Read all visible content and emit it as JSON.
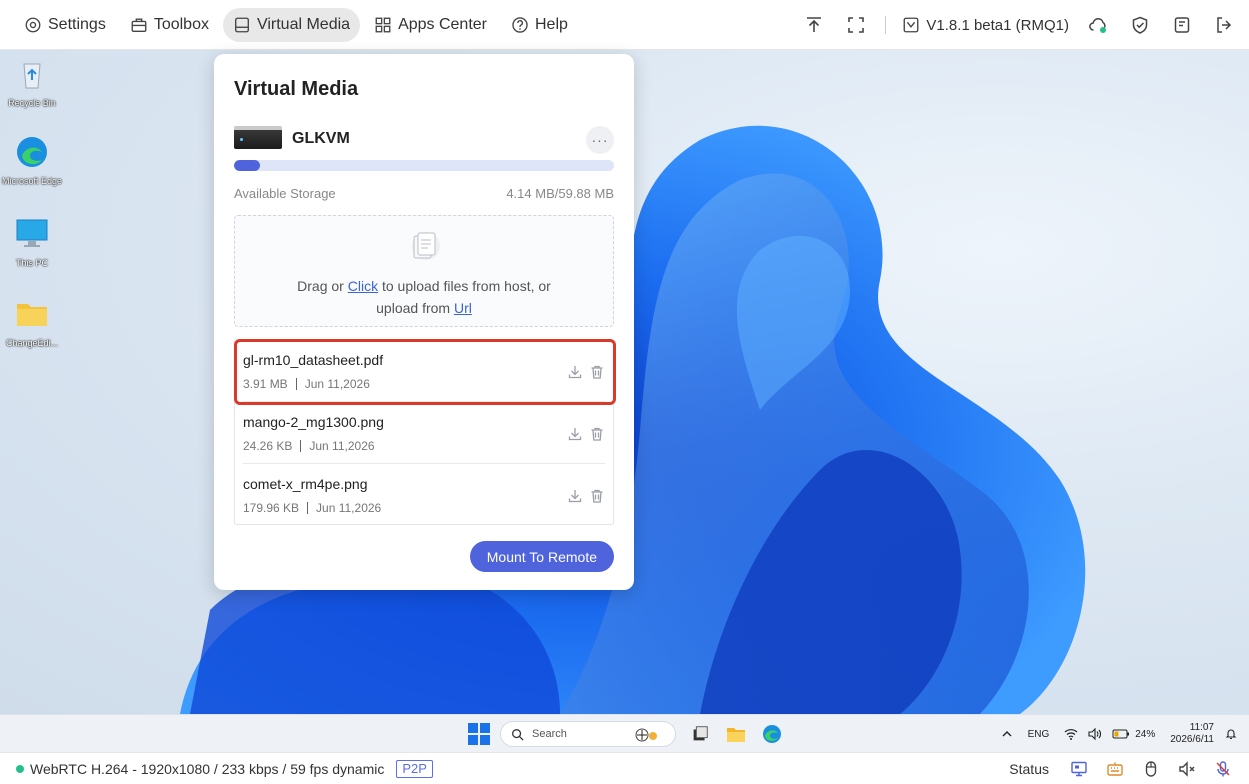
{
  "toolbar": {
    "nav": [
      {
        "label": "Settings",
        "icon": "gear-icon"
      },
      {
        "label": "Toolbox",
        "icon": "toolbox-icon"
      },
      {
        "label": "Virtual Media",
        "icon": "drive-icon",
        "active": true
      },
      {
        "label": "Apps Center",
        "icon": "apps-icon"
      },
      {
        "label": "Help",
        "icon": "help-icon"
      }
    ],
    "version": "V1.8.1 beta1 (RMQ1)"
  },
  "desktop": {
    "icons": [
      {
        "label": "Recycle Bin"
      },
      {
        "label": "Microsoft Edge"
      },
      {
        "label": "This PC"
      },
      {
        "label": "ChangeEdi..."
      }
    ]
  },
  "panel": {
    "title": "Virtual Media",
    "device_name": "GLKVM",
    "more_label": "···",
    "storage_label": "Available Storage",
    "storage_value": "4.14 MB/59.88 MB",
    "storage_used_fraction": 0.069,
    "upload": {
      "text_1": "Drag or ",
      "link_click": "Click",
      "text_2": " to upload files from host, or",
      "text_3": "upload from ",
      "link_url": "Url"
    },
    "files": [
      {
        "name": "gl-rm10_datasheet.pdf",
        "size": "3.91 MB",
        "date": "Jun 11,2026"
      },
      {
        "name": "mango-2_mg1300.png",
        "size": "24.26 KB",
        "date": "Jun 11,2026"
      },
      {
        "name": "comet-x_rm4pe.png",
        "size": "179.96 KB",
        "date": "Jun 11,2026"
      }
    ],
    "mount_label": "Mount To Remote"
  },
  "taskbar": {
    "search_placeholder": "Search",
    "lang": "ENG",
    "battery": "24%",
    "time": "11:07",
    "date": "2026/6/11"
  },
  "statusbar": {
    "stream": "WebRTC H.264 - 1920x1080 /  233 kbps / 59 fps dynamic",
    "badge": "P2P",
    "status_label": "Status"
  },
  "colors": {
    "accent": "#4f63dc",
    "highlight": "#d93a2b",
    "status_ok": "#22c08a"
  }
}
